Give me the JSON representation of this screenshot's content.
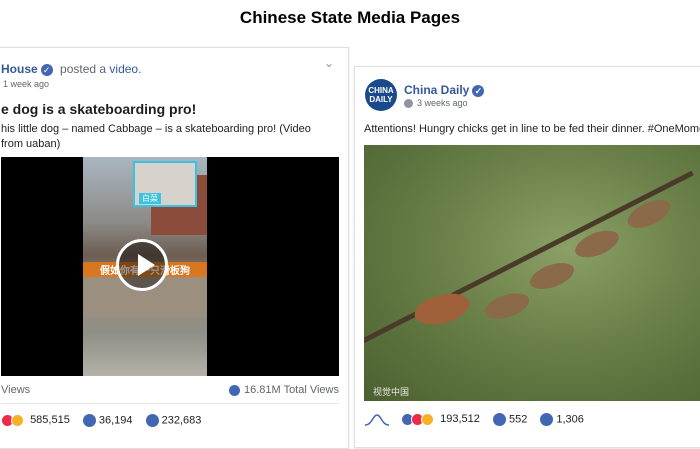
{
  "page_title": "Chinese State Media Pages",
  "left_post": {
    "page_name": "House",
    "action_text": "posted a",
    "action_link": "video.",
    "time": "1 week ago",
    "title": "e dog is a skateboarding pro!",
    "description": "his little dog – named Cabbage – is a skateboarding pro! (Video from uaban)",
    "video_overlay_label": "白菜",
    "video_caption": "假如你有一只滑板狗",
    "views_label": "Views",
    "total_views": "16.81M Total Views",
    "reactions_count": "585,515",
    "comments_count": "36,194",
    "shares_count": "232,683"
  },
  "right_post": {
    "page_name": "China Daily",
    "avatar_text": "CHINA DAILY",
    "time": "3 weeks ago",
    "text": "Attentions! Hungry chicks get in line to be fed their dinner. #OneMoment",
    "watermark": "视觉中国",
    "reactions_count": "193,512",
    "comments_count": "552",
    "shares_count": "1,306"
  },
  "icons": {
    "verified": "verified-badge-icon",
    "globe": "globe-icon",
    "comment": "comment-icon",
    "share": "share-icon",
    "play": "play-icon",
    "chevron": "chevron-down-icon"
  },
  "colors": {
    "link": "#365899",
    "verified": "#4267b2",
    "muted": "#606770"
  }
}
